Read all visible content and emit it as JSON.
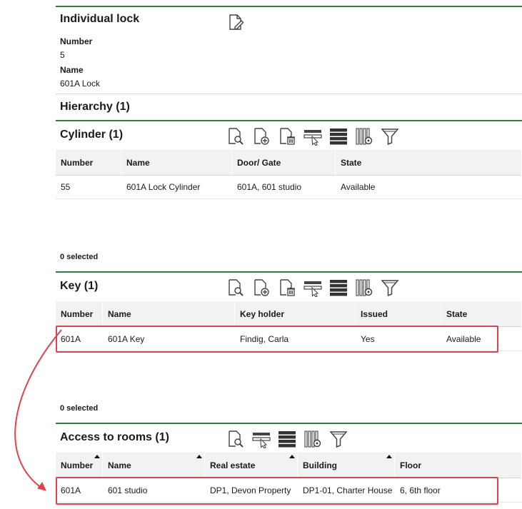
{
  "lock": {
    "title": "Individual lock",
    "number_label": "Number",
    "number_value": "5",
    "name_label": "Name",
    "name_value": "601A Lock"
  },
  "hierarchy": {
    "title": "Hierarchy (1)"
  },
  "cylinder": {
    "title": "Cylinder (1)",
    "columns": [
      "Number",
      "Name",
      "Door/ Gate",
      "State"
    ],
    "rows": [
      [
        "55",
        "601A Lock Cylinder",
        "601A, 601 studio",
        "Available"
      ]
    ],
    "selected": "0 selected"
  },
  "key": {
    "title": "Key (1)",
    "columns": [
      "Number",
      "Name",
      "Key holder",
      "Issued",
      "State"
    ],
    "rows": [
      [
        "601A",
        "601A Key",
        "Findig, Carla",
        "Yes",
        "Available"
      ]
    ],
    "selected": "0 selected"
  },
  "rooms": {
    "title": "Access to rooms (1)",
    "columns": [
      "Number",
      "Name",
      "Real estate",
      "Building",
      "Floor"
    ],
    "rows": [
      [
        "601A",
        "601 studio",
        "DP1, Devon Property",
        "DP1-01, Charter House",
        "6, 6th floor"
      ]
    ]
  },
  "icons": {
    "edit": "edit-document-icon",
    "view": "view-details-icon",
    "add": "add-record-icon",
    "delete": "delete-record-icon",
    "select": "select-row-icon",
    "rows": "row-density-icon",
    "columns": "column-settings-icon",
    "filter": "filter-icon"
  },
  "colors": {
    "accent": "#2e7d45",
    "highlight": "#e0434b",
    "header_bg": "#f2f2f2"
  }
}
